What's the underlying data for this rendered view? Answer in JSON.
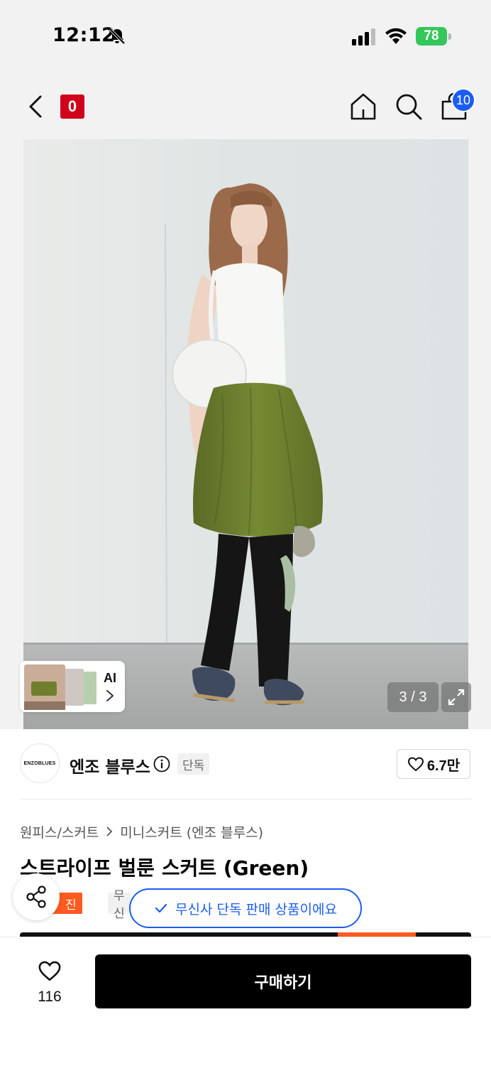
{
  "status_bar": {
    "time": "12:12",
    "battery": "78"
  },
  "nav": {
    "brand_logo_text": "0",
    "cart_count": "10"
  },
  "gallery": {
    "counter": "3 / 3",
    "ai_label": "AI"
  },
  "brand": {
    "avatar_text": "ENZOBLUES",
    "name": "엔조 블루스",
    "exclusive_tag": "단독",
    "like_count": "6.7만"
  },
  "breadcrumb": {
    "category": "원피스/스커트",
    "subcategory": "미니스커트 (엔조 블루스)"
  },
  "product": {
    "title": "스트라이프 벌룬 스커트 (Green)"
  },
  "tags": {
    "tag1": "무진장",
    "tag2": "무신"
  },
  "toast": {
    "message": "무신사 단독 판매 상품이에요"
  },
  "bottom_bar": {
    "like_count": "116",
    "buy_label": "구매하기"
  },
  "colors": {
    "accent_blue": "#1c5cf3",
    "brand_red": "#d0021b",
    "orange_tag": "#ff5a1f",
    "battery_green": "#34c759"
  }
}
